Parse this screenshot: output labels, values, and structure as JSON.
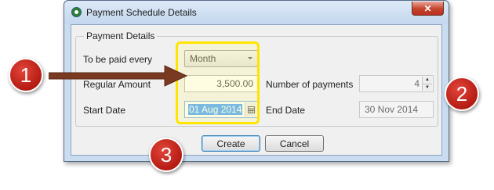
{
  "window": {
    "title": "Payment Schedule Details",
    "close_glyph": "✕"
  },
  "group": {
    "legend": "Payment Details"
  },
  "form": {
    "frequency_label": "To be paid every",
    "frequency_value": "Month",
    "amount_label": "Regular Amount",
    "amount_value": "3,500.00",
    "payments_label": "Number of payments",
    "payments_value": "4",
    "start_label": "Start Date",
    "start_value": "01 Aug 2014",
    "end_label": "End Date",
    "end_value": "30 Nov 2014"
  },
  "buttons": {
    "create": "Create",
    "cancel": "Cancel"
  },
  "callouts": {
    "one": "1",
    "two": "2",
    "three": "3"
  },
  "icons": {
    "calendar": "calendar-icon",
    "spin_up": "▲",
    "spin_down": "▼"
  },
  "colors": {
    "callout_red": "#c62a1f",
    "highlight_yellow": "#ffe400",
    "arrow_brown": "#7a3a22"
  }
}
